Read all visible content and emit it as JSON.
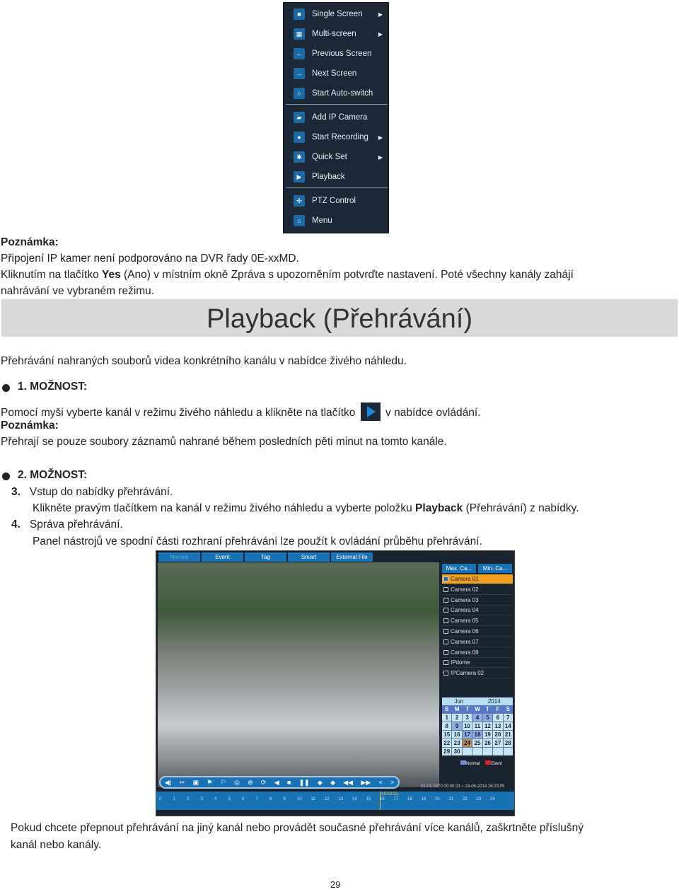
{
  "menu": {
    "items": [
      {
        "label": "Single Screen",
        "icon": "camera-icon",
        "submenu": true
      },
      {
        "label": "Multi-screen",
        "icon": "grid-icon",
        "submenu": true
      },
      {
        "label": "Previous Screen",
        "icon": "arrow-left-icon",
        "submenu": false
      },
      {
        "label": "Next Screen",
        "icon": "arrow-right-icon",
        "submenu": false
      },
      {
        "label": "Start Auto-switch",
        "icon": "circle-icon",
        "submenu": false
      },
      {
        "label": "Add IP Camera",
        "icon": "ip-camera-icon",
        "submenu": false
      },
      {
        "label": "Start Recording",
        "icon": "record-icon",
        "submenu": true
      },
      {
        "label": "Quick Set",
        "icon": "gear-icon",
        "submenu": true
      },
      {
        "label": "Playback",
        "icon": "play-icon",
        "submenu": false
      },
      {
        "label": "PTZ Control",
        "icon": "ptz-icon",
        "submenu": false
      },
      {
        "label": "Menu",
        "icon": "home-icon",
        "submenu": false
      }
    ]
  },
  "note1": {
    "heading": "Poznámka:",
    "line1": "Připojení IP kamer není podporováno na DVR řady 0E-xxMD.",
    "line2a": "Kliknutím na tlačítko ",
    "line2b": "Yes",
    "line2c": " (Ano) v místním okně Zpráva s upozorněním potvrďte nastavení. Poté všechny kanály zahájí",
    "line3": "nahrávání ve vybraném režimu."
  },
  "section_title": "Playback (Přehrávání)",
  "intro": "Přehrávání nahraných souborů videa konkrétního kanálu v nabídce živého náhledu.",
  "option1": {
    "heading": "1. MOŽNOST:",
    "text_a": "Pomocí myši vyberte kanál v režimu živého náhledu a klikněte na tlačítko",
    "text_b": "v nabídce ovládání.",
    "note_heading": "Poznámka:",
    "note": "Přehrají se pouze soubory záznamů nahrané během posledních pěti minut na tomto kanále."
  },
  "option2": {
    "heading": "2. MOŽNOST:",
    "step3_num": "3.",
    "step3_title": "Vstup do nabídky přehrávání.",
    "step3_a": "Klikněte pravým tlačítkem na kanál v režimu živého náhledu a vyberte položku ",
    "step3_b": "Playback",
    "step3_c": " (Přehrávání) z nabídky.",
    "step4_num": "4.",
    "step4_title": "Správa přehrávání.",
    "step4_text": "Panel nástrojů ve spodní části rozhraní přehrávání lze použít k ovládání průběhu přehrávání."
  },
  "playback_ui": {
    "tabs": [
      "Normal",
      "Event",
      "Tag",
      "Smart",
      "External File"
    ],
    "buttons": [
      "Max. Ca...",
      "Min. Ca..."
    ],
    "cameras": [
      "Camera 01",
      "Camera 02",
      "Camera 03",
      "Camera 04",
      "Camera 05",
      "Camera 06",
      "Camera 07",
      "Camera 08",
      "IPdome",
      "IPCamera 02"
    ],
    "month": "Jun",
    "year": "2014",
    "weekdays": [
      "S",
      "M",
      "T",
      "W",
      "T",
      "F",
      "S"
    ],
    "days": [
      "1",
      "2",
      "3",
      "4",
      "5",
      "6",
      "7",
      "8",
      "9",
      "10",
      "11",
      "12",
      "13",
      "14",
      "15",
      "16",
      "17",
      "18",
      "19",
      "20",
      "21",
      "22",
      "23",
      "24",
      "25",
      "26",
      "27",
      "28",
      "29",
      "30"
    ],
    "record_days": [
      "4",
      "5",
      "9",
      "17",
      "18"
    ],
    "selected_day": "24",
    "legend": [
      "Normal",
      "Event"
    ],
    "time_range": "01-01-1970 00:00:23 ~ 24-06-2014 16:23:05",
    "cursor_time": "16:03:33",
    "hours": [
      "0",
      "1",
      "2",
      "3",
      "4",
      "5",
      "6",
      "7",
      "8",
      "9",
      "10",
      "11",
      "12",
      "13",
      "14",
      "15",
      "16",
      "17",
      "18",
      "19",
      "20",
      "21",
      "22",
      "23",
      "24"
    ]
  },
  "footer_text1": "Pokud chcete přepnout přehrávání na jiný kanál nebo provádět současné přehrávání více kanálů, zaškrtněte příslušný",
  "footer_text2": "kanál nebo kanály.",
  "page_number": "29"
}
